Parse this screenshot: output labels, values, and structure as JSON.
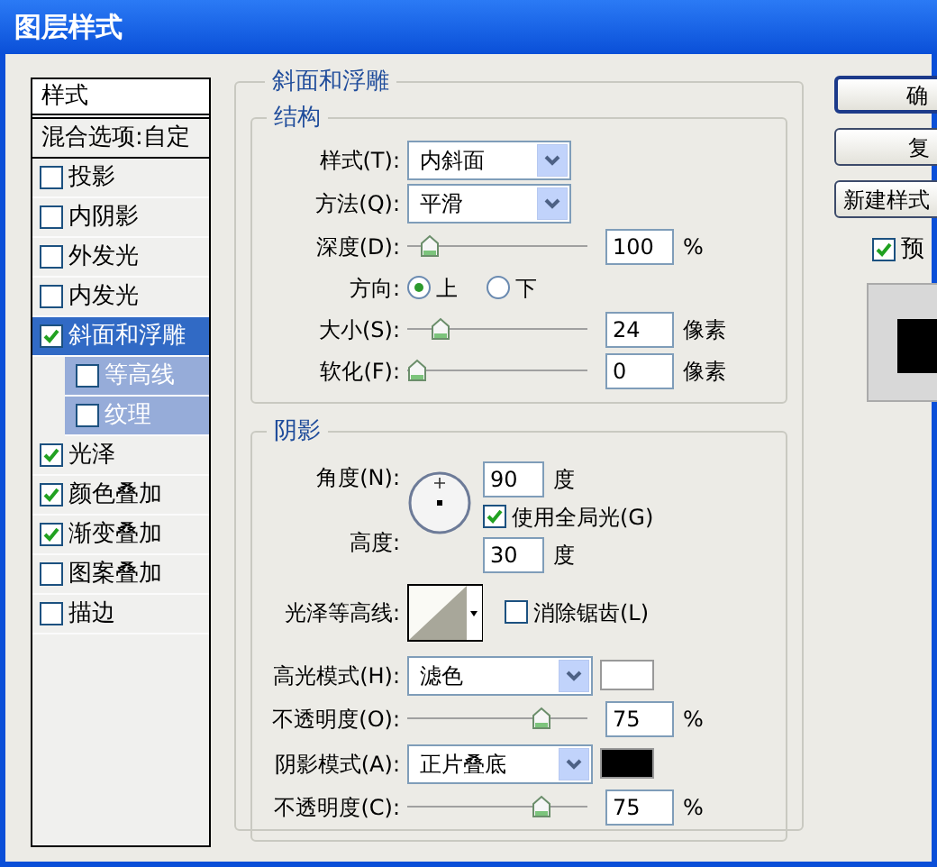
{
  "window": {
    "title": "图层样式"
  },
  "styles_list": {
    "items": [
      {
        "kind": "header",
        "label": "样式"
      },
      {
        "kind": "option",
        "label": "混合选项:自定"
      },
      {
        "kind": "check",
        "label": "投影",
        "checked": false,
        "selected": false
      },
      {
        "kind": "check",
        "label": "内阴影",
        "checked": false,
        "selected": false
      },
      {
        "kind": "check",
        "label": "外发光",
        "checked": false,
        "selected": false
      },
      {
        "kind": "check",
        "label": "内发光",
        "checked": false,
        "selected": false
      },
      {
        "kind": "check",
        "label": "斜面和浮雕",
        "checked": true,
        "selected": true,
        "children": [
          {
            "label": "等高线",
            "checked": false
          },
          {
            "label": "纹理",
            "checked": false
          }
        ]
      },
      {
        "kind": "check",
        "label": "光泽",
        "checked": true,
        "selected": false
      },
      {
        "kind": "check",
        "label": "颜色叠加",
        "checked": true,
        "selected": false
      },
      {
        "kind": "check",
        "label": "渐变叠加",
        "checked": true,
        "selected": false
      },
      {
        "kind": "check",
        "label": "图案叠加",
        "checked": false,
        "selected": false
      },
      {
        "kind": "check",
        "label": "描边",
        "checked": false,
        "selected": false
      }
    ]
  },
  "bevel": {
    "title": "斜面和浮雕",
    "structure": {
      "title": "结构",
      "style": {
        "label": "样式(T):",
        "value": "内斜面"
      },
      "technique": {
        "label": "方法(Q):",
        "value": "平滑"
      },
      "depth": {
        "label": "深度(D):",
        "level": 0.08,
        "value": "100",
        "unit": "%"
      },
      "direction": {
        "label": "方向:",
        "options": [
          {
            "label": "上",
            "selected": true
          },
          {
            "label": "下",
            "selected": false
          }
        ]
      },
      "size": {
        "label": "大小(S):",
        "level": 0.15,
        "value": "24",
        "unit": "像素"
      },
      "soften": {
        "label": "软化(F):",
        "level": 0,
        "value": "0",
        "unit": "像素"
      }
    },
    "shading": {
      "title": "阴影",
      "angle": {
        "label": "角度(N):",
        "value": "90",
        "unit": "度"
      },
      "global_light": {
        "label": "使用全局光(G)",
        "checked": true
      },
      "altitude": {
        "label": "高度:",
        "value": "30",
        "unit": "度"
      },
      "gloss_contour": {
        "label": "光泽等高线:"
      },
      "anti_aliased": {
        "label": "消除锯齿(L)",
        "checked": false
      },
      "highlight_mode": {
        "label": "高光模式(H):",
        "value": "滤色",
        "color": "#ffffff"
      },
      "highlight_opacity": {
        "label": "不透明度(O):",
        "level": 0.78,
        "value": "75",
        "unit": "%"
      },
      "shadow_mode": {
        "label": "阴影模式(A):",
        "value": "正片叠底",
        "color": "#000000"
      },
      "shadow_opacity": {
        "label": "不透明度(C):",
        "level": 0.78,
        "value": "75",
        "unit": "%"
      }
    }
  },
  "buttons": [
    {
      "label": "确"
    },
    {
      "label": "复"
    },
    {
      "label": "新建样式"
    }
  ],
  "preview": {
    "label": "预",
    "checked": true
  }
}
